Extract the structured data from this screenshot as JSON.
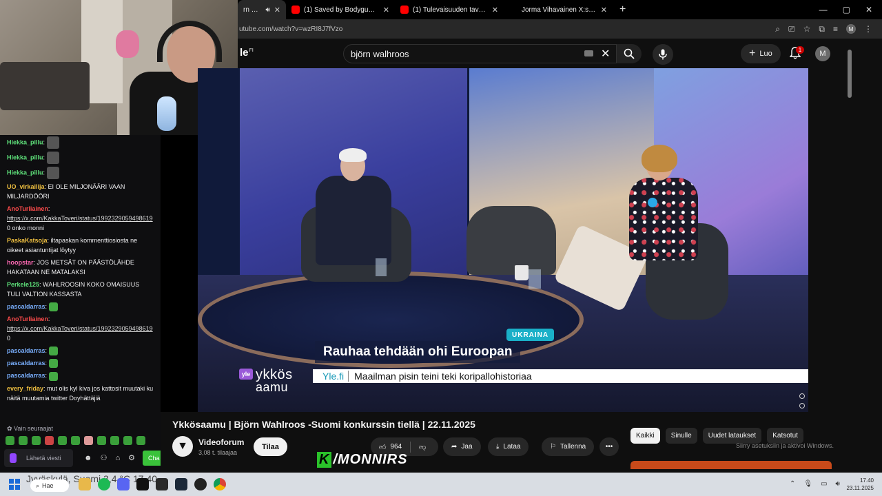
{
  "browser": {
    "tabs": [
      {
        "title": "rn Wahl",
        "active": true,
        "color": "#cc0000"
      },
      {
        "title": "(1) Saved by Bodyguards in Ma",
        "color": "#ff0000"
      },
      {
        "title": "(1) Tulevaisuuden tavoite | 300",
        "color": "#ff0000"
      },
      {
        "title": "Jorma Vihavainen X:ssä: \"Björn",
        "color": "#000000"
      }
    ],
    "new_tab": "+",
    "url": "utube.com/watch?v=wzRI8J7fVzo",
    "window_controls": [
      "—",
      "▢",
      "✕"
    ]
  },
  "youtube": {
    "logo": "le",
    "logo_sup": "FI",
    "search_query": "björn walhroos",
    "create_label": "Luo",
    "notification_count": "1",
    "avatar_letter": "M"
  },
  "video": {
    "tag": "UKRAINA",
    "headline": "Rauhaa tehdään ohi Euroopan",
    "ticker_source": "Yle.fi",
    "ticker_text": "Maailman pisin teini teki koripallohistoriaa",
    "yle_badge": "yle",
    "yle_show_1": "ykkös",
    "yle_show_2": "aamu"
  },
  "meta": {
    "title": "Ykkösaamu | Björn Wahlroos -Suomi konkurssin tiellä | 22.11.2025",
    "channel": "Videoforum",
    "subscribers": "3,08 t. tilaajaa",
    "subscribe_label": "Tilaa",
    "likes": "964",
    "share_label": "Jaa",
    "download_label": "Lataa",
    "save_label": "Tallenna",
    "more_label": "•••"
  },
  "chips": [
    "Kaikki",
    "Sinulle",
    "Uudet lataukset",
    "Katsotut"
  ],
  "windows_activation": "Siirry asetuksiin ja aktivoi Windows.",
  "watermark": {
    "k": "K",
    "text": "/MONNIRS"
  },
  "chat": {
    "messages": [
      {
        "user": "Hiekka_pillu",
        "text": ":",
        "color": "#5ee07a",
        "emote": true
      },
      {
        "user": "Hiekka_pillu",
        "text": ":",
        "color": "#5ee07a",
        "emote": true
      },
      {
        "user": "Hiekka_pillu",
        "text": ":",
        "color": "#5ee07a",
        "emote": true
      },
      {
        "user": "UO_virkailija",
        "text": ": EI OLE MILJONÄÄRI VAAN MILJARDÖÖRI",
        "color": "#f0c040"
      },
      {
        "user": "AnoTurliainen",
        "text": ":",
        "color": "#ff4b4b",
        "link": "https://x.com/KakkaToveri/status/1992329059498619",
        "after": "0 onko monni"
      },
      {
        "user": "PaskaKatsoja",
        "text": ": iltapaskan kommenttiosiosta ne oikeet asiantuntijat löytyy",
        "color": "#f0c040"
      },
      {
        "user": "hoopstar",
        "text": ": JOS METSÄT ON PÄÄSTÖLÄHDE HAKATAAN NE MATALAKSI",
        "color": "#ff69b4"
      },
      {
        "user": "Perkele125",
        "text": ": WAHLROOSIN KOKO OMAISUUS TULI VALTION KASSASTA",
        "color": "#5ee07a"
      },
      {
        "user": "pascaldarras",
        "text": ":",
        "color": "#7ab0ff",
        "emote": true
      },
      {
        "user": "AnoTurliainen",
        "text": ":",
        "color": "#ff4b4b",
        "link": "https://x.com/KakkaToveri/status/1992329059498619",
        "after": "0"
      },
      {
        "user": "pascaldarras",
        "text": ":",
        "color": "#7ab0ff",
        "emote": true
      },
      {
        "user": "pascaldarras",
        "text": ":",
        "color": "#7ab0ff",
        "emote": true
      },
      {
        "user": "pascaldarras",
        "text": ":",
        "color": "#7ab0ff",
        "emote": true
      },
      {
        "user": "every_friday",
        "text": ": mut olis kyl kiva jos kattosit muutaki ku näitä muutamia twitter Doyhättäjiä",
        "color": "#f0c040"
      }
    ],
    "mode": "Vain seuraajat",
    "input_placeholder": "Lähetä viesti",
    "send_label": "Cha"
  },
  "taskbar": {
    "weather": "Jyväskylä, Suomi  3,4 °C  17.40",
    "search": "Hae",
    "time": "17.40",
    "date": "23.11.2025"
  }
}
